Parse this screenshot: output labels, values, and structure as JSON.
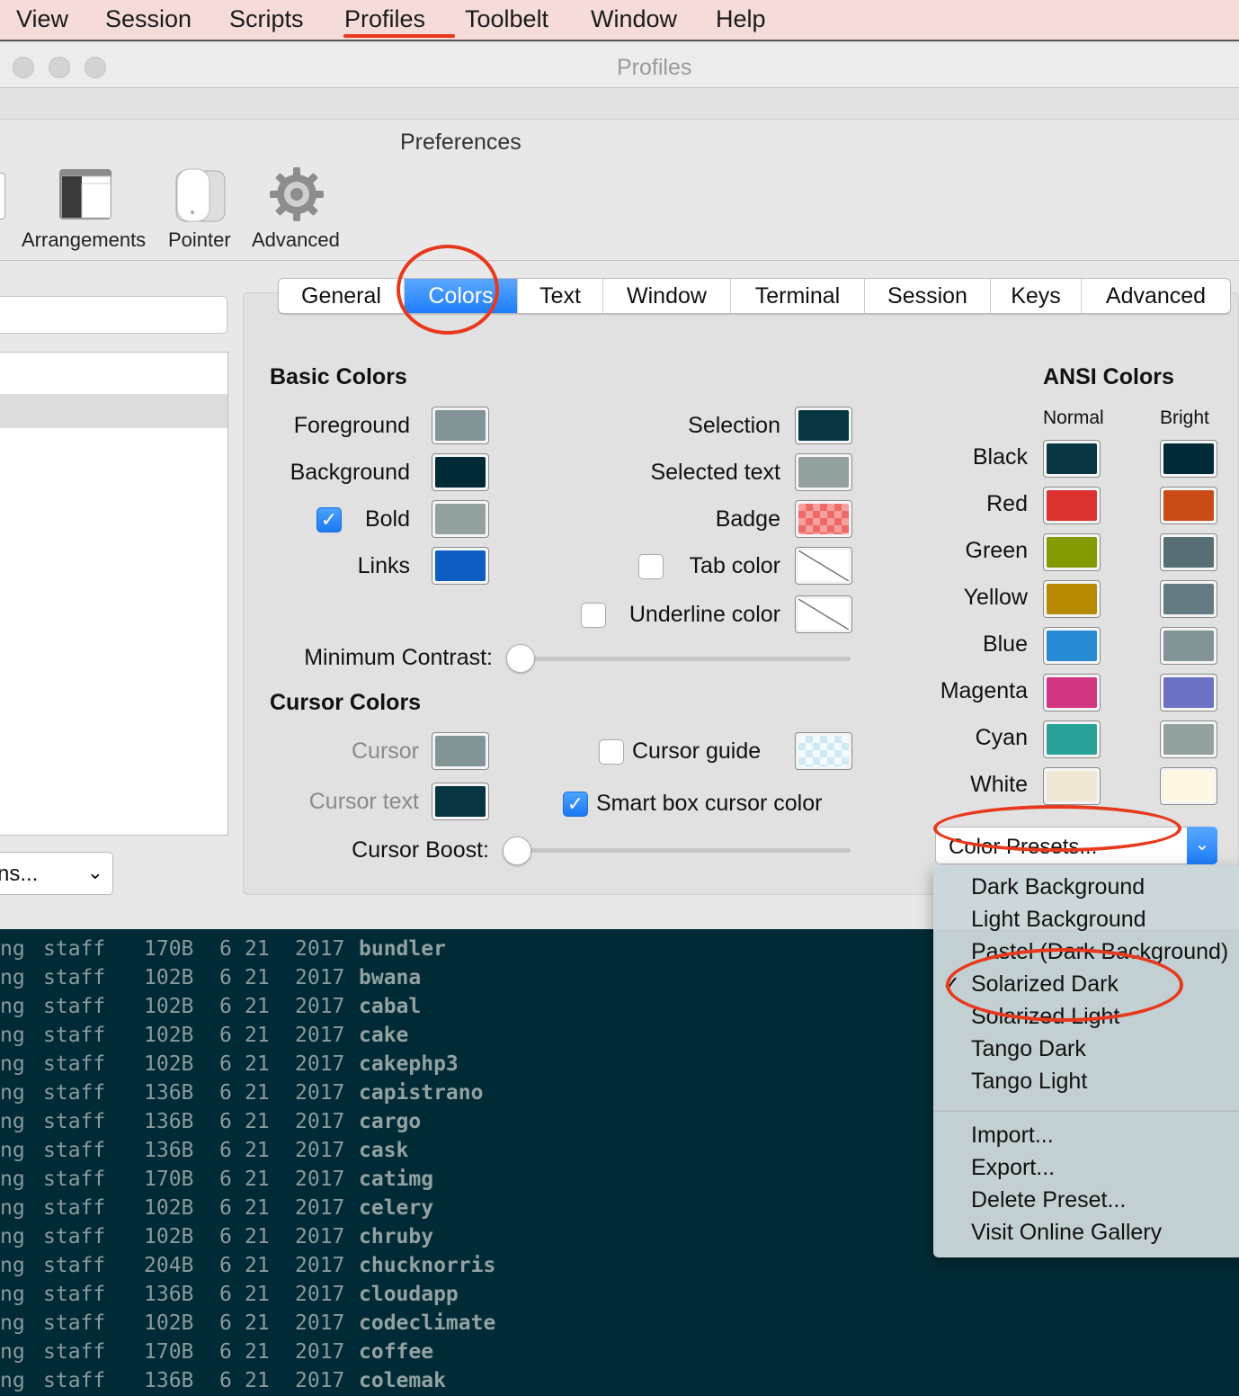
{
  "menubar": {
    "items": [
      "View",
      "Session",
      "Scripts",
      "Profiles",
      "Toolbelt",
      "Window",
      "Help"
    ]
  },
  "window": {
    "title": "Profiles"
  },
  "preferences": {
    "title": "Preferences",
    "toolbar": [
      "Arrangements",
      "Pointer",
      "Advanced"
    ]
  },
  "sidebar": {
    "actions_label": "ns..."
  },
  "tabs": [
    "General",
    "Colors",
    "Text",
    "Window",
    "Terminal",
    "Session",
    "Keys",
    "Advanced"
  ],
  "basic_colors": {
    "title": "Basic Colors",
    "foreground": {
      "label": "Foreground",
      "color": "#839496"
    },
    "background": {
      "label": "Background",
      "color": "#002b36"
    },
    "bold": {
      "label": "Bold",
      "color": "#93a1a1",
      "checked": true
    },
    "links": {
      "label": "Links",
      "color": "#0d5ec0"
    },
    "selection": {
      "label": "Selection",
      "color": "#073642"
    },
    "selected_text": {
      "label": "Selected text",
      "color": "#93a1a1"
    },
    "badge": {
      "label": "Badge"
    },
    "tab_color": {
      "label": "Tab color",
      "checked": false
    },
    "underline_color": {
      "label": "Underline color",
      "checked": false
    },
    "minimum_contrast": {
      "label": "Minimum Contrast:",
      "value": 0
    }
  },
  "cursor_colors": {
    "title": "Cursor Colors",
    "cursor": {
      "label": "Cursor",
      "color": "#839496"
    },
    "cursor_text": {
      "label": "Cursor text",
      "color": "#073642"
    },
    "cursor_guide": {
      "label": "Cursor guide",
      "checked": false
    },
    "smart_box": {
      "label": "Smart box cursor color",
      "checked": true
    },
    "cursor_boost": {
      "label": "Cursor Boost:",
      "value": 0
    }
  },
  "ansi": {
    "title": "ANSI Colors",
    "normal_label": "Normal",
    "bright_label": "Bright",
    "rows": [
      {
        "name": "Black",
        "normal": "#073642",
        "bright": "#002b36"
      },
      {
        "name": "Red",
        "normal": "#dc322f",
        "bright": "#cb4b16"
      },
      {
        "name": "Green",
        "normal": "#859900",
        "bright": "#586e75"
      },
      {
        "name": "Yellow",
        "normal": "#b58900",
        "bright": "#657b83"
      },
      {
        "name": "Blue",
        "normal": "#268bd2",
        "bright": "#839496"
      },
      {
        "name": "Magenta",
        "normal": "#d33682",
        "bright": "#6c71c4"
      },
      {
        "name": "Cyan",
        "normal": "#2aa198",
        "bright": "#93a1a1"
      },
      {
        "name": "White",
        "normal": "#eee8d5",
        "bright": "#fdf6e3"
      }
    ]
  },
  "color_presets": {
    "label": "Color Presets...",
    "items": [
      "Dark Background",
      "Light Background",
      "Pastel (Dark Background)",
      "Solarized Dark",
      "Solarized Light",
      "Tango Dark",
      "Tango Light"
    ],
    "checked": "Solarized Dark",
    "actions": [
      "Import...",
      "Export...",
      "Delete Preset...",
      "Visit Online Gallery"
    ]
  },
  "terminal": {
    "rows": [
      {
        "prefix": "ng",
        "group": "staff",
        "size": "170B",
        "month": "6",
        "day": "21",
        "year": "2017",
        "name": "bundler"
      },
      {
        "prefix": "ng",
        "group": "staff",
        "size": "102B",
        "month": "6",
        "day": "21",
        "year": "2017",
        "name": "bwana"
      },
      {
        "prefix": "ng",
        "group": "staff",
        "size": "102B",
        "month": "6",
        "day": "21",
        "year": "2017",
        "name": "cabal"
      },
      {
        "prefix": "ng",
        "group": "staff",
        "size": "102B",
        "month": "6",
        "day": "21",
        "year": "2017",
        "name": "cake"
      },
      {
        "prefix": "ng",
        "group": "staff",
        "size": "102B",
        "month": "6",
        "day": "21",
        "year": "2017",
        "name": "cakephp3"
      },
      {
        "prefix": "ng",
        "group": "staff",
        "size": "136B",
        "month": "6",
        "day": "21",
        "year": "2017",
        "name": "capistrano"
      },
      {
        "prefix": "ng",
        "group": "staff",
        "size": "136B",
        "month": "6",
        "day": "21",
        "year": "2017",
        "name": "cargo"
      },
      {
        "prefix": "ng",
        "group": "staff",
        "size": "136B",
        "month": "6",
        "day": "21",
        "year": "2017",
        "name": "cask"
      },
      {
        "prefix": "ng",
        "group": "staff",
        "size": "170B",
        "month": "6",
        "day": "21",
        "year": "2017",
        "name": "catimg"
      },
      {
        "prefix": "ng",
        "group": "staff",
        "size": "102B",
        "month": "6",
        "day": "21",
        "year": "2017",
        "name": "celery"
      },
      {
        "prefix": "ng",
        "group": "staff",
        "size": "102B",
        "month": "6",
        "day": "21",
        "year": "2017",
        "name": "chruby"
      },
      {
        "prefix": "ng",
        "group": "staff",
        "size": "204B",
        "month": "6",
        "day": "21",
        "year": "2017",
        "name": "chucknorris"
      },
      {
        "prefix": "ng",
        "group": "staff",
        "size": "136B",
        "month": "6",
        "day": "21",
        "year": "2017",
        "name": "cloudapp"
      },
      {
        "prefix": "ng",
        "group": "staff",
        "size": "102B",
        "month": "6",
        "day": "21",
        "year": "2017",
        "name": "codeclimate"
      },
      {
        "prefix": "ng",
        "group": "staff",
        "size": "170B",
        "month": "6",
        "day": "21",
        "year": "2017",
        "name": "coffee"
      },
      {
        "prefix": "ng",
        "group": "staff",
        "size": "136B",
        "month": "6",
        "day": "21",
        "year": "2017",
        "name": "colemak"
      }
    ]
  },
  "annotation_color": "#e8391c"
}
